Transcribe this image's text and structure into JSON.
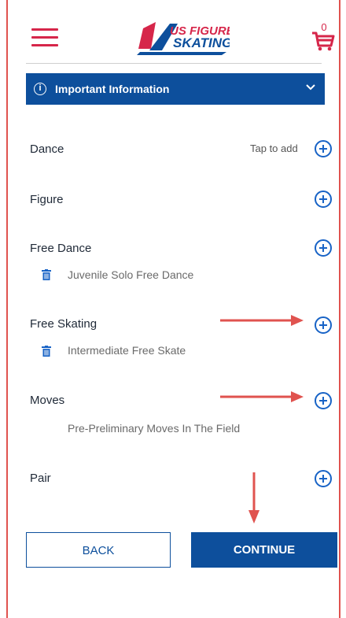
{
  "header": {
    "logo_line1": "US FIGURE",
    "logo_line2": "SKATING",
    "cart_count": "0"
  },
  "info_bar": {
    "label": "Important Information"
  },
  "events": [
    {
      "label": "Dance",
      "hint": "Tap to add",
      "items": []
    },
    {
      "label": "Figure",
      "items": []
    },
    {
      "label": "Free Dance",
      "items": [
        "Juvenile Solo Free Dance"
      ]
    },
    {
      "label": "Free Skating",
      "items": [
        "Intermediate Free Skate"
      ]
    },
    {
      "label": "Moves",
      "items": [
        "Pre-Preliminary Moves In The Field"
      ]
    },
    {
      "label": "Pair",
      "items": []
    }
  ],
  "buttons": {
    "back": "BACK",
    "continue": "CONTINUE"
  },
  "colors": {
    "brand_blue": "#0d4f9c",
    "accent_red": "#d6264a",
    "plus_blue": "#1863c6",
    "annotation_red": "#e0534f"
  }
}
